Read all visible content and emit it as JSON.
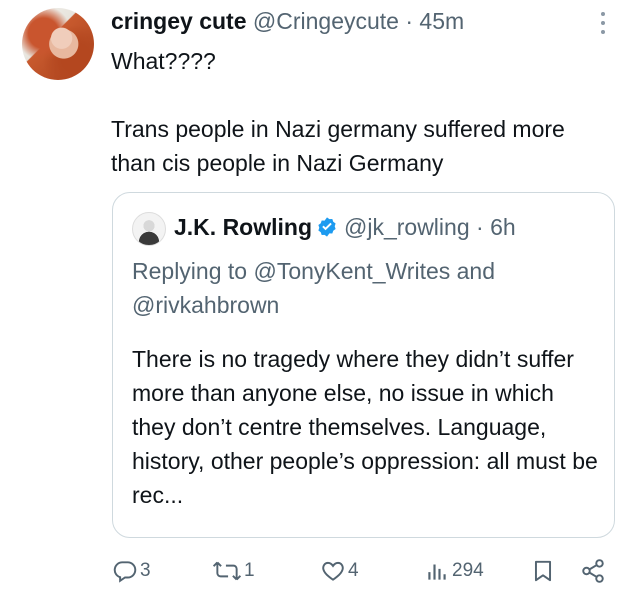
{
  "tweet": {
    "author_name": "cringey cute",
    "author_handle": "@Cringeycute",
    "separator": "·",
    "time": "45m",
    "text": "What????\n\nTrans people in Nazi germany suffered more than cis people in Nazi Germany"
  },
  "quote": {
    "author_name": "J.K. Rowling",
    "author_handle": "@jk_rowling",
    "separator": "·",
    "time": "6h",
    "reply_prefix": "Replying to",
    "reply_user1": "@TonyKent_Writes",
    "reply_and": "and",
    "reply_user2": "@rivkahbrown",
    "text": "There is no tragedy where they didn’t suffer more than anyone else, no issue in which they don’t centre themselves. Language, history, other people’s oppression: all must be rec..."
  },
  "actions": {
    "replies": "3",
    "retweets": "1",
    "likes": "4",
    "views": "294"
  },
  "colors": {
    "text": "#0f1419",
    "secondary": "#536471",
    "border": "#cfd9de",
    "verified": "#1d9bf0"
  },
  "icons": [
    "more-icon",
    "reply-icon",
    "retweet-icon",
    "like-icon",
    "views-icon",
    "bookmark-icon",
    "share-icon",
    "verified-icon"
  ]
}
